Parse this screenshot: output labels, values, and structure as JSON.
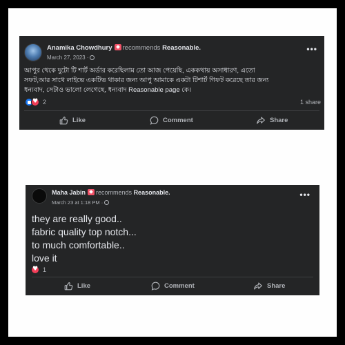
{
  "posts": [
    {
      "author": "Anamika Chowdhury",
      "recommends_text": "recommends",
      "page": "Reasonable.",
      "date": "March 27, 2023 ·",
      "body": "আপুর থেকে দুটো টি শার্ট অর্ডার করেছিলাম তো আজ পেয়েছি, এককথায় অসাধারণ, এতো\nসফট,আর সাথে লাইভে একটিভ থাকার জন্য আপু আমাকে একটা টিশার্ট গিফট করেছে তার জন্য\nধন্যবাদ, সেটাও ভালো লেগেছে, ধন্যবাদ  Reasonable page কে।",
      "reaction_count": "2",
      "shares": "1 share",
      "actions": {
        "like": "Like",
        "comment": "Comment",
        "share": "Share"
      }
    },
    {
      "author": "Maha Jabin",
      "recommends_text": "recommends",
      "page": "Reasonable.",
      "date": "March 23 at 1:18 PM ·",
      "body": "they are really good..\nfabric quality top notch...\nto much comfortable..\nlove it",
      "reaction_count": "1",
      "actions": {
        "like": "Like",
        "comment": "Comment",
        "share": "Share"
      }
    }
  ],
  "icons": {
    "more": "more-options-icon",
    "globe": "globe-icon",
    "like": "thumbs-up-icon",
    "comment": "comment-bubble-icon",
    "share": "share-arrow-icon",
    "recommend": "recommend-badge-icon"
  },
  "colors": {
    "post_background": "#242526",
    "text_primary": "#e4e6eb",
    "text_secondary": "#b0b3b8",
    "like_blue": "#1877f2",
    "love_red": "#f33e58"
  }
}
